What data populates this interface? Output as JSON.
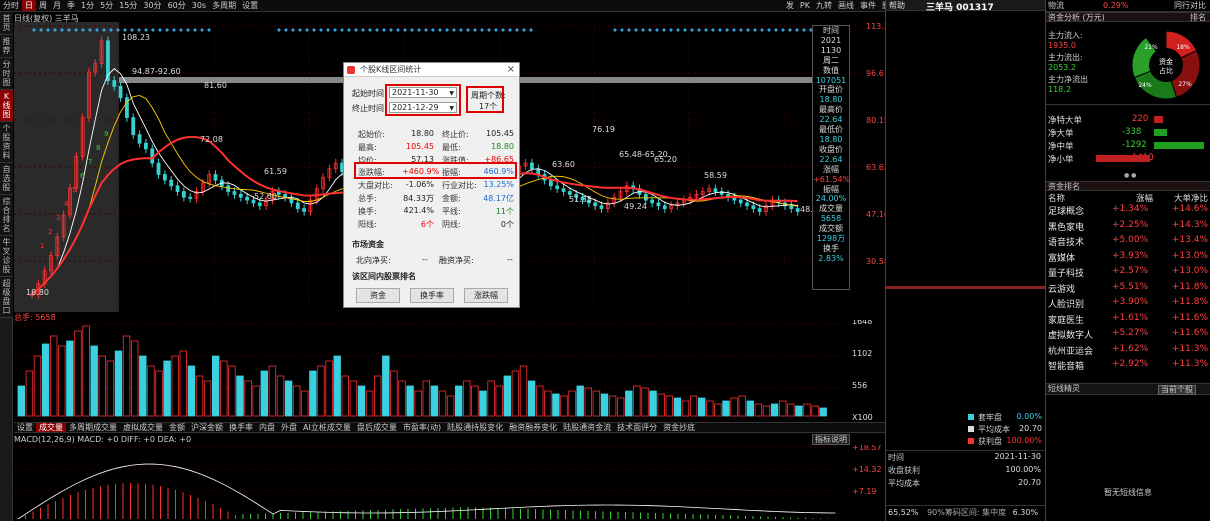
{
  "toolbar": {
    "items": [
      "分时",
      "日",
      "周",
      "月",
      "季",
      "1分",
      "5分",
      "15分",
      "30分",
      "60分",
      "30s",
      "多周期",
      "设置"
    ],
    "selected": 1,
    "right_items": [
      "发",
      "PK",
      "九转",
      "画线",
      "事件",
      "删自选",
      "均线",
      "复权",
      "叠加",
      "统计",
      "画线",
      "更多"
    ]
  },
  "vtabs": [
    "首页",
    "推荐",
    "分时图",
    "K线图",
    "个股资料",
    "自选股",
    "综合排名",
    "牛叉诊股",
    "超级盘口"
  ],
  "vtab_active": 3,
  "chart_header": {
    "left": "日线(复权) 三羊马",
    "note": "MA5: MA10: MA20: MA30:"
  },
  "kline": {
    "price_axis": [
      "113.20",
      "96.67",
      "80.15",
      "63.63",
      "47.10",
      "30.58"
    ],
    "labels": {
      "high": "108.23",
      "gap": "94.87-92.60",
      "p81": "81.60",
      "p72": "72.08",
      "p61": "61.59",
      "p52": "52.60",
      "p76": "76.19",
      "p63": "63.60",
      "p6548": "65.48-65.20",
      "p6520": "65.20",
      "p5859": "58.59",
      "p5351": "51.35",
      "p4924": "49.24",
      "p48": "48.3",
      "p1880": "18.80"
    }
  },
  "info_col": {
    "rows": [
      "时间",
      "2021",
      "1130",
      "周二",
      "数值",
      "107051",
      "开盘价",
      "18.80",
      "最高价",
      "22.64",
      "最低价",
      "18.80",
      "收盘价",
      "22.64",
      "涨幅",
      "+61.54%",
      "振幅",
      "24.00%",
      "成交量",
      "5658",
      "成交额",
      "1298万",
      "换手",
      "2.83%"
    ]
  },
  "volume": {
    "label": "总手: 5658",
    "axis": [
      "1648",
      "1102",
      "556",
      "X100"
    ]
  },
  "tabs": [
    "设置",
    "成交量",
    "多周期成交量",
    "虚拟成交量",
    "金额",
    "沪深金额",
    "换手率",
    "内盘",
    "外盘",
    "AI立桩成交量",
    "盘后成交量",
    "市盈率(动)",
    "陆股通持股变化",
    "融资融券变化",
    "陆股通资金流",
    "技术面评分",
    "资金抄底"
  ],
  "tab_selected": 1,
  "macd": {
    "label": "MACD(12,26,9) MACD: +0 DIFF: +0 DEA: +0",
    "btn": "指标说明",
    "axis": [
      "+18.57",
      "+14.32",
      "+7.19"
    ]
  },
  "dialog": {
    "title": "个股K线区间统计",
    "start_label": "起始时间:",
    "start_value": "2021-11-30",
    "end_label": "终止时间:",
    "end_value": "2021-12-29",
    "period_label": "周期个数:",
    "period_value": "17个",
    "rows": [
      [
        "起始价:",
        "18.80",
        "终止价:",
        "105.45"
      ],
      [
        "最高:",
        "105.45",
        "最低:",
        "18.80"
      ],
      [
        "均价:",
        "57.13",
        "涨跌值:",
        "+86.65"
      ],
      [
        "涨跌幅:",
        "+460.9%",
        "振幅:",
        "460.9%"
      ],
      [
        "大盘对比:",
        "-1.06%",
        "行业对比:",
        "13.25%"
      ],
      [
        "总手:",
        "84.33万",
        "金额:",
        "48.17亿"
      ],
      [
        "换手:",
        "421.4%",
        "平线:",
        "11个"
      ],
      [
        "阳线:",
        "6个",
        "阴线:",
        "0个"
      ]
    ],
    "fund_section": "市场资金",
    "north": "北向净买:",
    "north_val": "--",
    "margin": "融资净买:",
    "margin_val": "--",
    "rank_section": "该区间内股票排名",
    "buttons": [
      "资金",
      "换手率",
      "涨跌幅"
    ]
  },
  "rp1": {
    "help": "帮助",
    "stock_title": "三羊马 001317",
    "legend": [
      [
        "套牢盘",
        "0.00%"
      ],
      [
        "平均成本",
        "20.70"
      ],
      [
        "获利盘",
        "100.00%"
      ]
    ],
    "legend_colors": [
      "#3ad0e0",
      "#dddddd",
      "#ff3030"
    ],
    "stats": [
      [
        "时间",
        "2021-11-30"
      ],
      [
        "收盘获利",
        "100.00%"
      ],
      [
        "平均成本",
        "20.70"
      ]
    ],
    "bottom": [
      "65.52%",
      "90%筹码区间: 集中度",
      "6.30%"
    ]
  },
  "rp2": {
    "top": [
      "物流",
      "0.29%",
      "同行对比"
    ],
    "funds_title": "资金分析 (万元)",
    "rank_btn": "排名",
    "flows": [
      [
        "主力流入:",
        "1935.0"
      ],
      [
        "主力流出:",
        "2053.2"
      ],
      [
        "主力净流出",
        "118.2"
      ]
    ],
    "pie": {
      "center": "资金占比",
      "pcts": [
        "21%",
        "18%",
        "24%",
        "27%"
      ]
    },
    "net": [
      [
        "净特大单",
        "220"
      ],
      [
        "净大单",
        "-338"
      ],
      [
        "净中单",
        "-1292"
      ],
      [
        "净小单",
        "1410"
      ]
    ],
    "rank_title": "资金排名",
    "rank_head": [
      "名称",
      "涨幅",
      "大单净比"
    ],
    "rank": [
      [
        "足球概念",
        "+1.34%",
        "+14.6%"
      ],
      [
        "黑色家电",
        "+2.25%",
        "+14.3%"
      ],
      [
        "语音技术",
        "+5.00%",
        "+13.4%"
      ],
      [
        "富媒体",
        "+3.93%",
        "+13.0%"
      ],
      [
        "量子科技",
        "+2.57%",
        "+13.0%"
      ],
      [
        "云游戏",
        "+5.51%",
        "+11.8%"
      ],
      [
        "人脸识别",
        "+3.90%",
        "+11.8%"
      ],
      [
        "家庭医生",
        "+1.61%",
        "+11.6%"
      ],
      [
        "虚拟数字人",
        "+5.27%",
        "+11.6%"
      ],
      [
        "杭州亚运会",
        "+1.62%",
        "+11.3%"
      ],
      [
        "智能音箱",
        "+2.92%",
        "+11.3%"
      ]
    ],
    "genius_title": "短线精灵",
    "genius_opts": [
      "当前个股"
    ],
    "genius_empty": "暂无短线信息"
  }
}
